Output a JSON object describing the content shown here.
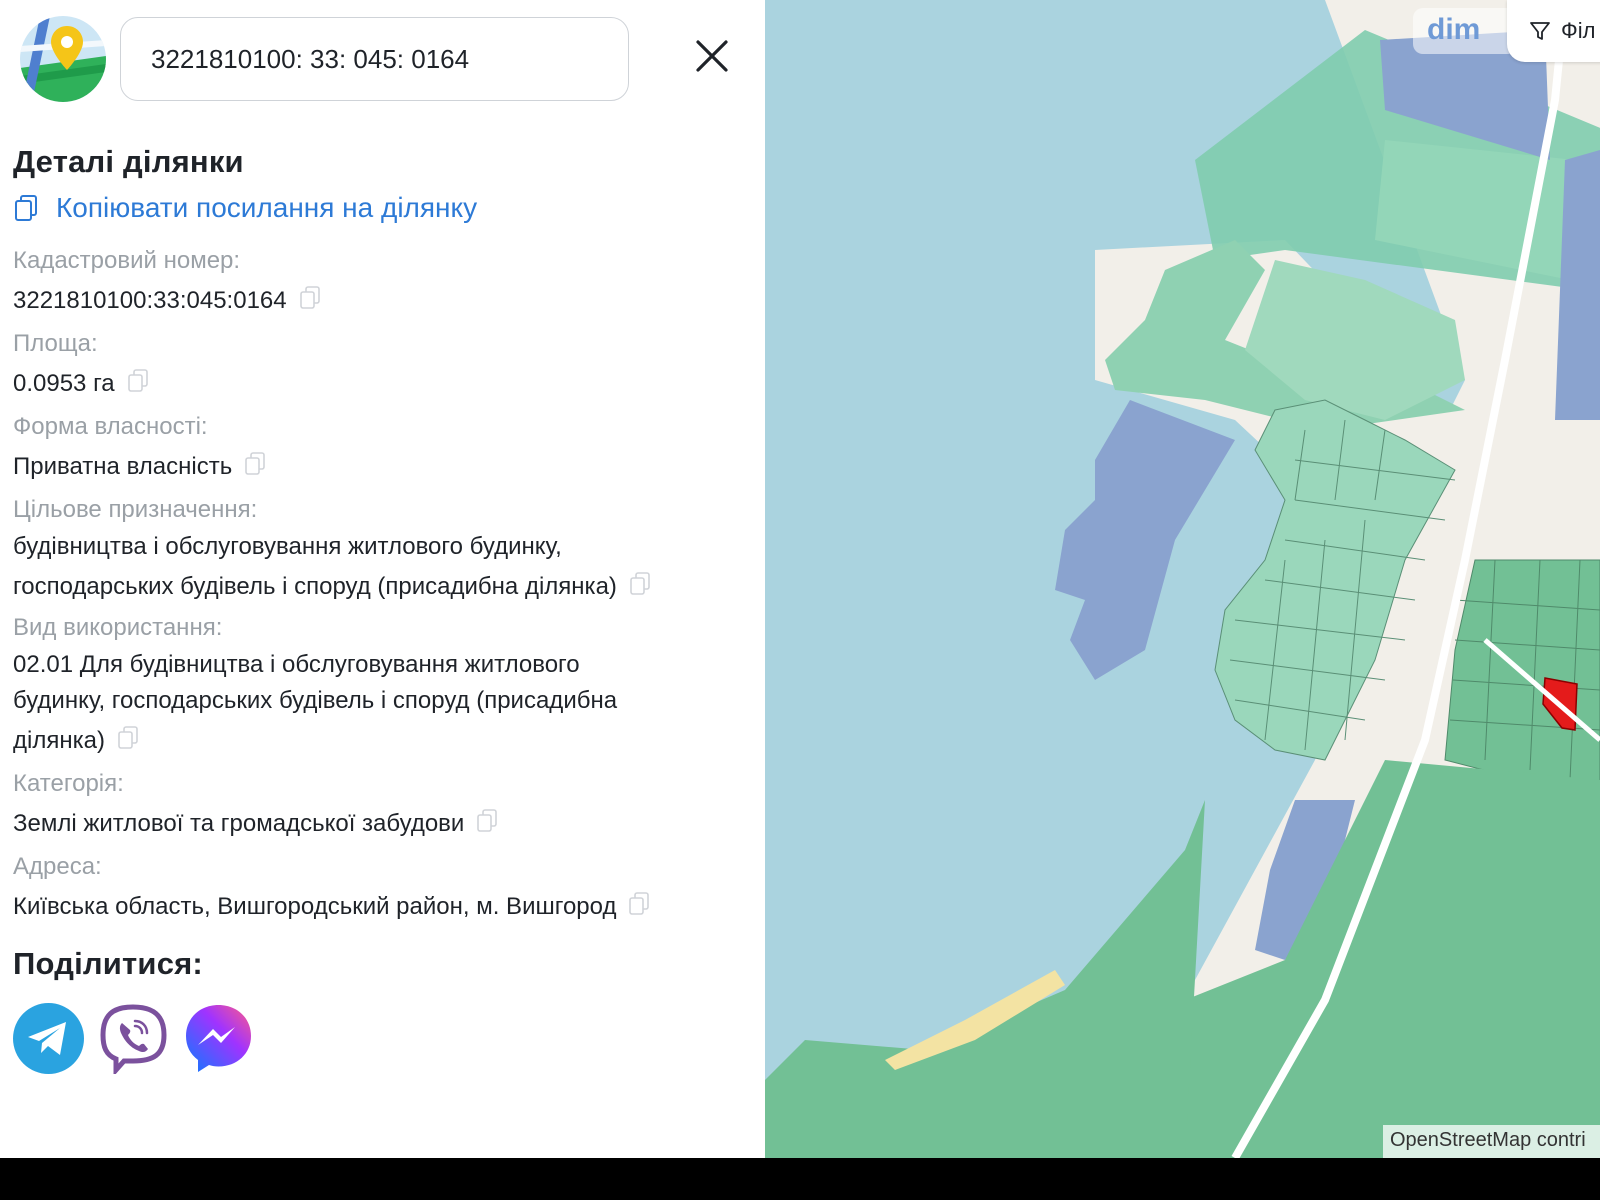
{
  "search": {
    "value": "3221810100: 33: 045: 0164"
  },
  "details": {
    "title": "Деталі ділянки",
    "copy_link_label": "Копіювати посилання на ділянку",
    "fields": [
      {
        "label": "Кадастровий номер:",
        "value": "3221810100:33:045:0164"
      },
      {
        "label": "Площа:",
        "value": "0.0953 га"
      },
      {
        "label": "Форма власності:",
        "value": "Приватна власність"
      },
      {
        "label": "Цільове призначення:",
        "value_lines": [
          "будівництва і обслуговування житлового будинку,",
          "господарських будівель і споруд (присадибна ділянка)"
        ]
      },
      {
        "label": "Вид використання:",
        "value_lines": [
          "02.01 Для будівництва і обслуговування житлового",
          "будинку, господарських будівель і споруд (присадибна",
          "ділянка)"
        ]
      },
      {
        "label": "Категорія:",
        "value": "Землі житлової та громадської забудови"
      },
      {
        "label": "Адреса:",
        "value": "Київська область, Вишгородський район, м. Вишгород"
      }
    ]
  },
  "share": {
    "title": "Поділитися:",
    "buttons": [
      {
        "icon": "telegram-icon",
        "color": "#2aa3e0"
      },
      {
        "icon": "viber-icon",
        "color": "#7b519d"
      },
      {
        "icon": "messenger-icon",
        "color": "#7d4cf5"
      }
    ]
  },
  "map": {
    "logo_text": "dim",
    "filter_label": "Філ",
    "attribution": "OpenStreetMap contri",
    "colors": {
      "water": "#aad3df",
      "park": "#72c095",
      "parcel": "#8fd1b2",
      "blue_parcel": "#8aa3cf",
      "selected": "#e41b1b"
    }
  }
}
